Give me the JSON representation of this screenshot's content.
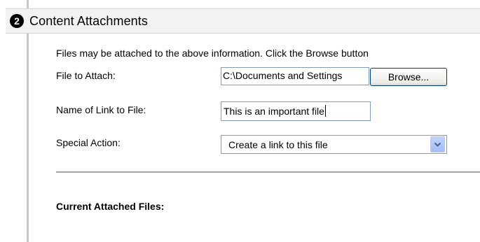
{
  "section": {
    "step": "2",
    "title": "Content Attachments"
  },
  "instructions": "Files may be attached to the above information. Click the Browse button",
  "file_to_attach": {
    "label": "File to Attach:",
    "value": "C:\\Documents and Settings",
    "browse_label": "Browse..."
  },
  "link_name": {
    "label": "Name of Link to File:",
    "value": "This is an important file"
  },
  "special_action": {
    "label": "Special Action:",
    "selected": "Create a link to this file",
    "icon": "chevron-down-icon"
  },
  "attached_files": {
    "label": "Current Attached Files:"
  },
  "colors": {
    "header_background": "#f2f2f2",
    "input_border": "#7f9db9",
    "dropdown_button": "#a6bef6",
    "divider": "#a8a8a8"
  }
}
